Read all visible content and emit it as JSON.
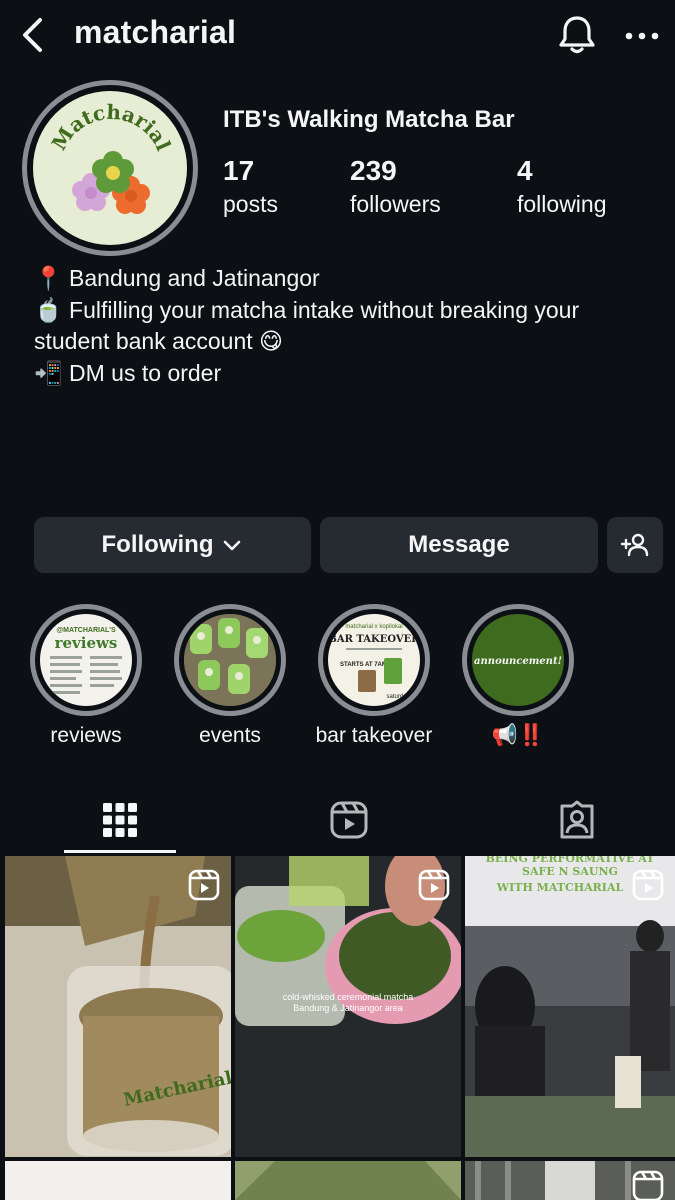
{
  "header": {
    "username": "matcharial"
  },
  "profile": {
    "display_name": "ITB's Walking Matcha Bar",
    "avatar_text": "Matcharial",
    "stats": [
      {
        "value": "17",
        "label": "posts"
      },
      {
        "value": "239",
        "label": "followers"
      },
      {
        "value": "4",
        "label": "following"
      }
    ],
    "bio": [
      "📍 Bandung and Jatinangor",
      "🍵 Fulfilling your matcha intake without breaking your",
      "student bank account 😋",
      "📲 DM us to order"
    ]
  },
  "actions": {
    "following_label": "Following",
    "message_label": "Message"
  },
  "highlights": [
    {
      "label": "reviews",
      "cover_title": "@MATCHARIAL'S",
      "cover_heading": "reviews"
    },
    {
      "label": "events"
    },
    {
      "label": "bar takeover",
      "cover_top": "matcharial x kopilokal",
      "cover_heading": "BAR TAKEOVER",
      "cover_note": "STARTS AT 7AM",
      "cover_day": "saturday"
    },
    {
      "label": "📢‼️",
      "cover_heading": "announcement!"
    }
  ],
  "tabs": [
    {
      "icon": "grid-icon",
      "active": true
    },
    {
      "icon": "reels-icon",
      "active": false
    },
    {
      "icon": "tagged-icon",
      "active": false
    }
  ],
  "posts": [
    {
      "type": "reel",
      "text": "Matcharial"
    },
    {
      "type": "reel",
      "text": "cold-whisked ceremonial matcha",
      "text2": "Bandung & Jatinangor area"
    },
    {
      "type": "reel",
      "text": "BEING PERFORMATIVE AT",
      "text2": "SAFE N SAUNG",
      "text3": "WITH MATCHARIAL"
    },
    {
      "type": "photo"
    },
    {
      "type": "photo"
    },
    {
      "type": "photo"
    }
  ],
  "colors": {
    "background": "#0c1014",
    "button": "#262a31",
    "ring": "#8a8d93",
    "matcha_green": "#3f6b1e"
  }
}
